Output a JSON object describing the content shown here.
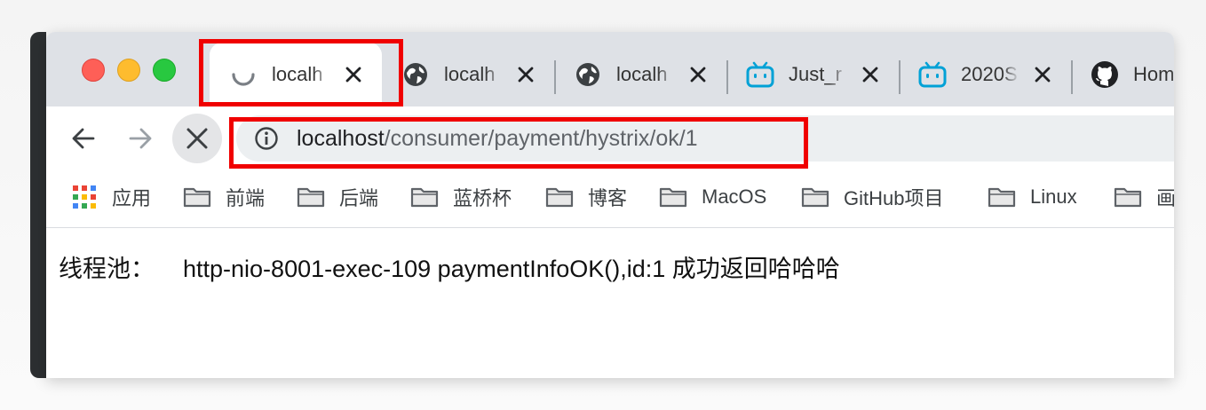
{
  "tabs": [
    {
      "title": "localh",
      "icon": "loading-spinner-icon",
      "active": true
    },
    {
      "title": "localh",
      "icon": "globe-icon",
      "active": false
    },
    {
      "title": "localh",
      "icon": "globe-icon",
      "active": false
    },
    {
      "title": "Just_r",
      "icon": "bilibili-icon",
      "active": false
    },
    {
      "title": "2020S",
      "icon": "bilibili-icon",
      "active": false
    },
    {
      "title": "Hom",
      "icon": "github-icon",
      "active": false
    }
  ],
  "toolbar": {
    "url_host": "localhost",
    "url_path": "/consumer/payment/hystrix/ok/1"
  },
  "bookmarks": {
    "apps_label": "应用",
    "folders": [
      "前端",
      "后端",
      "蓝桥杯",
      "博客",
      "MacOS",
      "GitHub项目",
      "Linux",
      "画"
    ]
  },
  "content": {
    "label": "线程池：",
    "message": "http-nio-8001-exec-109 paymentInfoOK(),id:1 成功返回哈哈哈"
  },
  "colors": {
    "highlight": "#f00000",
    "tabstrip": "#dee1e6",
    "omnibox": "#eceff1",
    "bilibili": "#00a1d6"
  }
}
